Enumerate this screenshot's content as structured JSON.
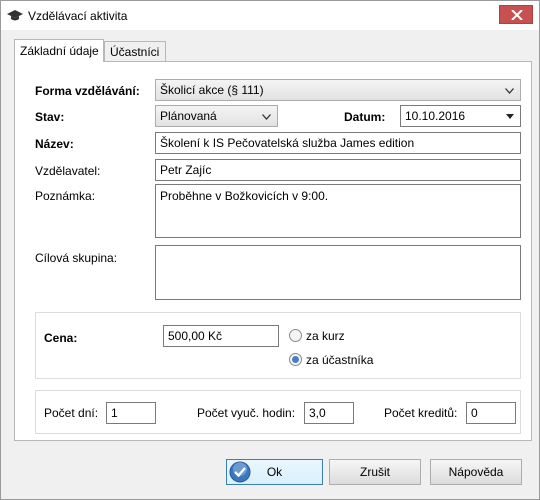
{
  "window": {
    "title": "Vzdělávací aktivita"
  },
  "tabs": [
    {
      "label": "Základní údaje"
    },
    {
      "label": "Účastníci"
    }
  ],
  "form": {
    "forma_label": "Forma vzdělávání:",
    "forma_value": "Školicí akce (§ 111)",
    "stav_label": "Stav:",
    "stav_value": "Plánovaná",
    "datum_label": "Datum:",
    "datum_value": "10.10.2016",
    "nazev_label": "Název:",
    "nazev_value": "Školení k IS Pečovatelská služba James edition",
    "vzdelavatel_label": "Vzdělavatel:",
    "vzdelavatel_value": "Petr Zajíc",
    "poznamka_label": "Poznámka:",
    "poznamka_value": "Proběhne v Božkovicích v 9:00.",
    "cilova_label": "Cílová skupina:",
    "cilova_value": ""
  },
  "price": {
    "label": "Cena:",
    "value": "500,00 Kč",
    "option_course": "za kurz",
    "option_participant": "za účastníka",
    "selected": "participant"
  },
  "counts": {
    "days_label": "Počet dní:",
    "days_value": "1",
    "hours_label": "Počet vyuč. hodin:",
    "hours_value": "3,0",
    "credits_label": "Počet kreditů:",
    "credits_value": "0"
  },
  "buttons": {
    "ok": "Ok",
    "cancel": "Zrušit",
    "help": "Nápověda"
  },
  "colors": {
    "close_button": "#c75050",
    "selected_radio": "#4a7ec8",
    "ok_icon": "#3a78c4"
  }
}
